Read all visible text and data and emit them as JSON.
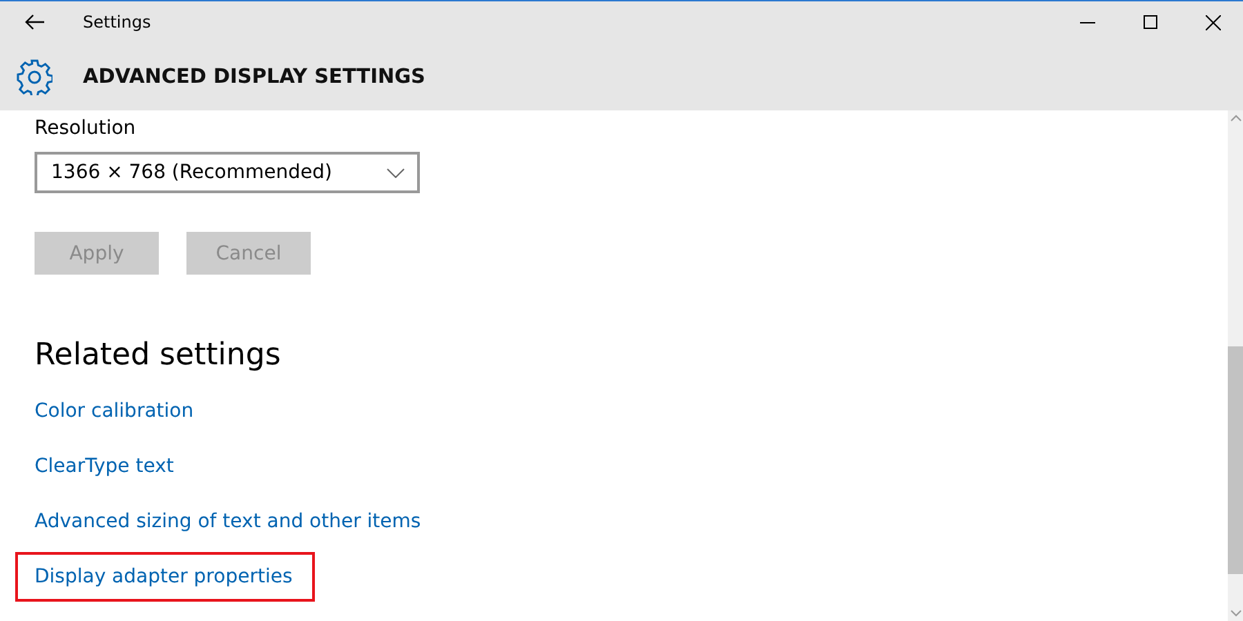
{
  "window": {
    "title": "Settings"
  },
  "header": {
    "title": "ADVANCED DISPLAY SETTINGS"
  },
  "resolution": {
    "label": "Resolution",
    "value": "1366 × 768 (Recommended)"
  },
  "buttons": [
    {
      "label": "Apply",
      "disabled": true
    },
    {
      "label": "Cancel",
      "disabled": true
    }
  ],
  "related": {
    "title": "Related settings",
    "links": [
      {
        "label": "Color calibration",
        "highlighted": false
      },
      {
        "label": "ClearType text",
        "highlighted": false
      },
      {
        "label": "Advanced sizing of text and other items",
        "highlighted": false
      },
      {
        "label": "Display adapter properties",
        "highlighted": true
      }
    ]
  }
}
